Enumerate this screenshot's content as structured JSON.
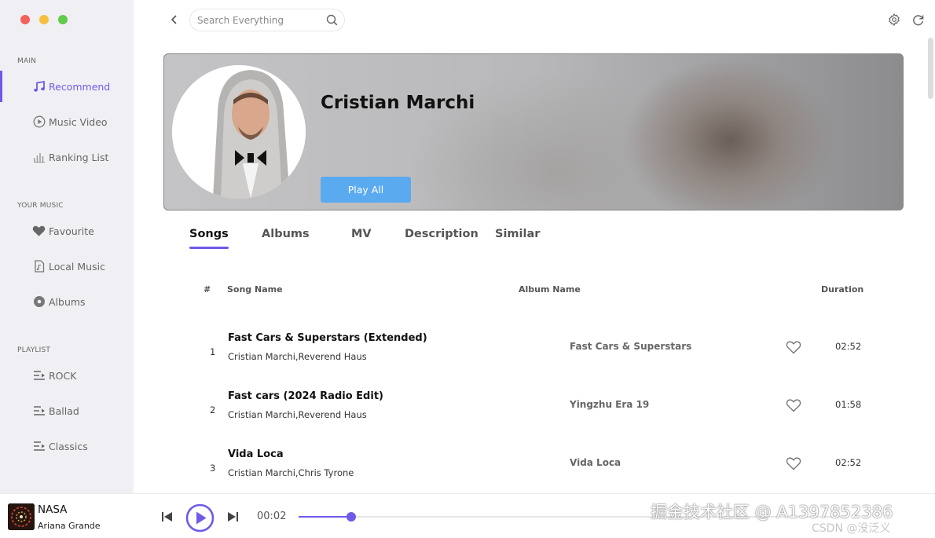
{
  "window": {
    "traffic_lights": [
      "#f2625a",
      "#f5be3b",
      "#5fcb4a"
    ]
  },
  "colors": {
    "accent": "#6d5be8",
    "play_all": "#5aaaf0"
  },
  "sidebar": {
    "sections": [
      {
        "label": "MAIN",
        "items": [
          {
            "label": "Recommend",
            "icon": "music-note-icon",
            "active": true
          },
          {
            "label": "Music Video",
            "icon": "play-circle-icon"
          },
          {
            "label": "Ranking List",
            "icon": "bar-chart-icon"
          }
        ]
      },
      {
        "label": "YOUR MUSIC",
        "items": [
          {
            "label": "Favourite",
            "icon": "heart-icon"
          },
          {
            "label": "Local Music",
            "icon": "file-icon"
          },
          {
            "label": "Albums",
            "icon": "disc-icon"
          }
        ]
      },
      {
        "label": "PLAYLIST",
        "items": [
          {
            "label": "ROCK",
            "icon": "playlist-icon"
          },
          {
            "label": "Ballad",
            "icon": "playlist-icon"
          },
          {
            "label": "Classics",
            "icon": "playlist-icon"
          }
        ]
      }
    ]
  },
  "topbar": {
    "search_placeholder": "Search Everything",
    "icons": [
      "back-icon",
      "search-icon",
      "settings-icon",
      "refresh-icon"
    ]
  },
  "artist": {
    "name": "Cristian Marchi",
    "play_all_label": "Play All"
  },
  "tabs": [
    {
      "label": "Songs",
      "active": true
    },
    {
      "label": "Albums"
    },
    {
      "label": "MV"
    },
    {
      "label": "Description"
    },
    {
      "label": "Similar"
    }
  ],
  "table": {
    "headers": {
      "num": "#",
      "song": "Song Name",
      "album": "Album Name",
      "duration": "Duration"
    },
    "rows": [
      {
        "num": "1",
        "title": "Fast Cars & Superstars (Extended)",
        "artists": "Cristian Marchi,Reverend Haus",
        "album": "Fast Cars & Superstars",
        "duration": "02:52"
      },
      {
        "num": "2",
        "title": "Fast cars (2024 Radio Edit)",
        "artists": "Cristian Marchi,Reverend Haus",
        "album": "Yingzhu Era 19",
        "duration": "01:58"
      },
      {
        "num": "3",
        "title": "Vida Loca",
        "artists": "Cristian Marchi,Chris Tyrone",
        "album": "Vida Loca",
        "duration": "02:52"
      }
    ]
  },
  "player": {
    "title": "NASA",
    "artist": "Ariana Grande",
    "current_time": "00:02",
    "progress": 0.095
  },
  "watermark": {
    "text": "掘金技术社区 @ A1397852386",
    "sub": "CSDN @没泛义"
  }
}
